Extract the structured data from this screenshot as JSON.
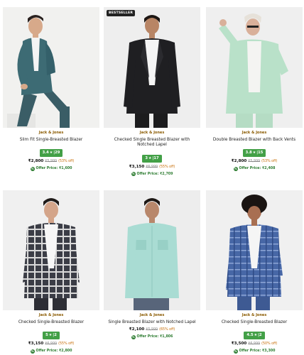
{
  "products": [
    {
      "brand": "Jack & Jones",
      "name": "Slim Fit Single-Breasted Blazer",
      "rating": "3.4",
      "rating_count": "29",
      "price": "₹2,800",
      "mrp": "₹5,999",
      "discount": "53% off",
      "offer": "Offer Price: ₹1,600",
      "badge": "",
      "image_colors": {
        "bg": "#f1f1ef",
        "garment": "#3d6b74",
        "shirt": "#f4f4f4",
        "pants": "#3a5d66"
      }
    },
    {
      "brand": "Jack & Jones",
      "name": "Checked Single Breasted Blazer with Notched Lapel",
      "rating": "3",
      "rating_count": "17",
      "price": "₹3,150",
      "mrp": "₹6,999",
      "discount": "55% off",
      "offer": "Offer Price: ₹2,709",
      "badge": "BESTSELLER",
      "image_colors": {
        "bg": "#eeeeee",
        "garment": "#1f1f22",
        "shirt": "#f5f5f5",
        "pants": "#1c1c1e"
      }
    },
    {
      "brand": "Jack & Jones",
      "name": "Double Breasted Blazer with Back Vents",
      "rating": "3.8",
      "rating_count": "15",
      "price": "₹2,800",
      "mrp": "₹5,999",
      "discount": "53% off",
      "offer": "Offer Price: ₹2,408",
      "badge": "",
      "image_colors": {
        "bg": "#efefef",
        "garment": "#b9e1c9",
        "shirt": "#f4f4f2",
        "pants": "#b5dcc4"
      }
    },
    {
      "brand": "Jack & Jones",
      "name": "Checked Single-Breasted Blazer",
      "rating": "5",
      "rating_count": "2",
      "price": "₹3,150",
      "mrp": "₹6,999",
      "discount": "55% off",
      "offer": "Offer Price: ₹2,800",
      "badge": "",
      "image_colors": {
        "bg": "#f0f0f0",
        "garment": "#3b3d46",
        "shirt": "#f7f7f7",
        "pants": "#2d2e35"
      }
    },
    {
      "brand": "Jack & Jones",
      "name": "Single Breasted Blazer with Notched Lapel",
      "rating": "",
      "rating_count": "",
      "price": "₹2,100",
      "mrp": "₹5,999",
      "discount": "65% off",
      "offer": "Offer Price: ₹1,806",
      "badge": "",
      "image_colors": {
        "bg": "#ededed",
        "garment": "#a9dcd3",
        "shirt": "#9fd4ca",
        "pants": "#58657a"
      }
    },
    {
      "brand": "Jack & Jones",
      "name": "Checked Single-Breasted Blazer",
      "rating": "4.5",
      "rating_count": "2",
      "price": "₹3,500",
      "mrp": "₹6,999",
      "discount": "50% off",
      "offer": "Offer Price: ₹3,300",
      "badge": "",
      "image_colors": {
        "bg": "#f0f0f0",
        "garment": "#4767a6",
        "shirt": "#f5f5f5",
        "pants": "#3e5a93"
      }
    }
  ]
}
